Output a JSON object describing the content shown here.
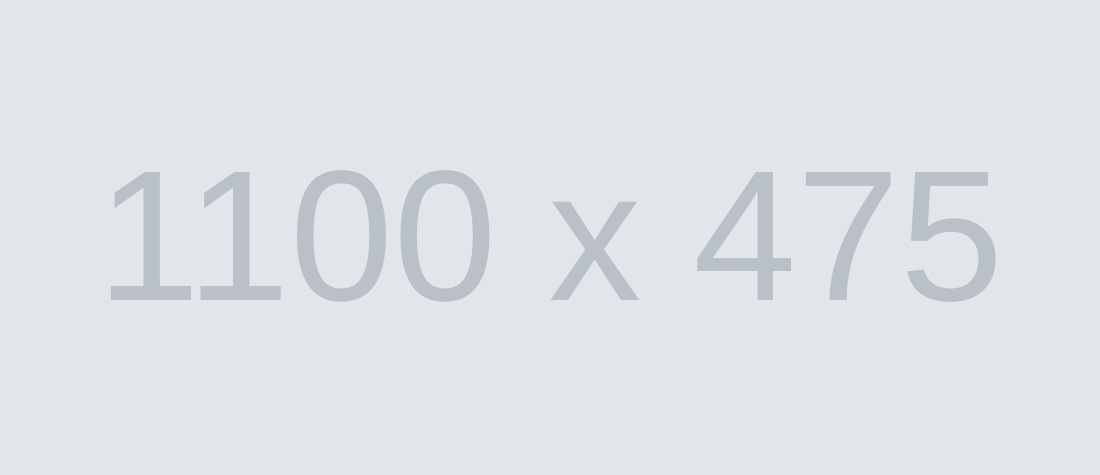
{
  "placeholder": {
    "label": "1100 x 475",
    "background_color": "#e2e6eb",
    "text_color": "#b9c0c8"
  }
}
